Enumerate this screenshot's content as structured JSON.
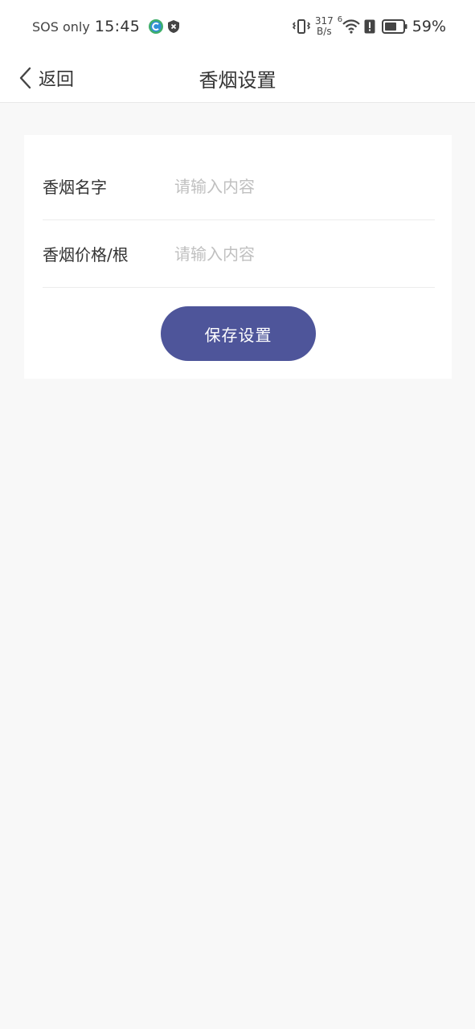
{
  "status_bar": {
    "carrier": "SOS only",
    "time": "15:45",
    "net_speed_value": "317",
    "net_speed_unit": "B/s",
    "wifi_generation": "6",
    "battery_percent": "59%",
    "icons": [
      "app-c-icon",
      "shield-x-icon",
      "vibrate-icon",
      "wifi-icon",
      "alert-icon",
      "battery-icon"
    ]
  },
  "nav": {
    "back_label": "返回",
    "title": "香烟设置",
    "back_icon": "chevron-left-icon"
  },
  "form": {
    "rows": [
      {
        "label": "香烟名字",
        "placeholder": "请输入内容",
        "value": ""
      },
      {
        "label": "香烟价格/根",
        "placeholder": "请输入内容",
        "value": ""
      }
    ],
    "save_label": "保存设置"
  },
  "colors": {
    "accent": "#4e559a",
    "background": "#f8f8f8",
    "card": "#ffffff",
    "placeholder": "#c0c0c0",
    "text": "#333333"
  }
}
